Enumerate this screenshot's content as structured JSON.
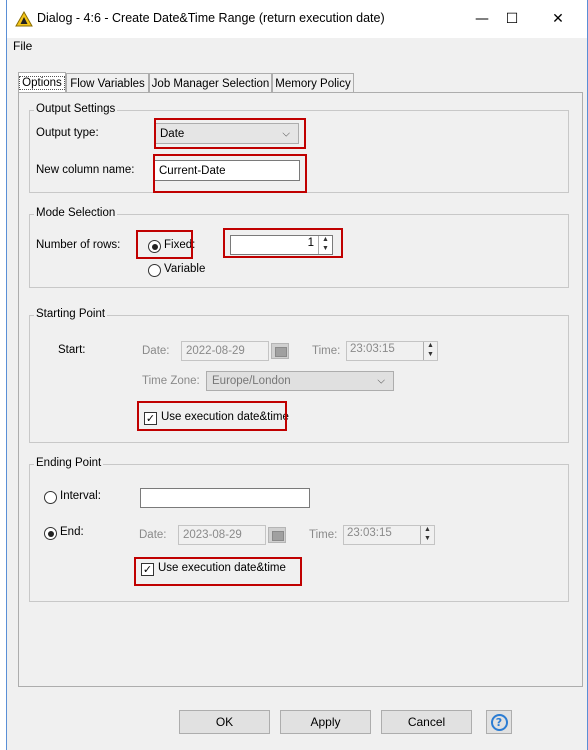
{
  "window": {
    "title": "Dialog - 4:6 - Create Date&Time Range (return execution date)",
    "minimize": "—",
    "maximize": "☐",
    "close": "✕"
  },
  "menu": {
    "file": "File"
  },
  "tabs": [
    "Options",
    "Flow Variables",
    "Job Manager Selection",
    "Memory Policy"
  ],
  "output_settings": {
    "title": "Output Settings",
    "output_type_label": "Output type:",
    "output_type_value": "Date",
    "column_name_label": "New column name:",
    "column_name_value": "Current-Date"
  },
  "mode_selection": {
    "title": "Mode Selection",
    "rows_label": "Number of rows:",
    "fixed_label": "Fixed:",
    "fixed_checked": true,
    "rows_value": "1",
    "variable_label": "Variable",
    "variable_checked": false
  },
  "starting_point": {
    "title": "Starting Point",
    "start_label": "Start:",
    "date_label": "Date:",
    "date_value": "2022-08-29",
    "time_label": "Time:",
    "time_value": "23:03:15",
    "timezone_label": "Time Zone:",
    "timezone_value": "Europe/London",
    "use_exec_label": "Use execution date&time",
    "use_exec_checked": true
  },
  "ending_point": {
    "title": "Ending Point",
    "interval_label": "Interval:",
    "interval_checked": false,
    "interval_value": "",
    "end_label": "End:",
    "end_checked": true,
    "date_label": "Date:",
    "date_value": "2023-08-29",
    "time_label": "Time:",
    "time_value": "23:03:15",
    "use_exec_label": "Use execution date&time",
    "use_exec_checked": true
  },
  "buttons": {
    "ok": "OK",
    "apply": "Apply",
    "cancel": "Cancel",
    "help": "?"
  },
  "colors": {
    "highlight": "#c00000",
    "help_blue": "#2b7cd3",
    "knime_yellow": "#f5c518"
  }
}
